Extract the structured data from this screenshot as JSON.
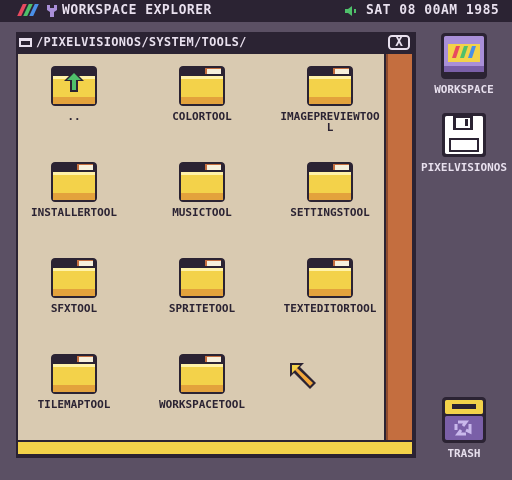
{
  "menubar": {
    "title": "WORKSPACE EXPLORER",
    "clock": "SAT 08 00AM 1985",
    "icons": [
      "pixelvision-logo-icon",
      "tool-icon",
      "speaker-icon"
    ]
  },
  "window": {
    "path": "/PIXELVISIONOS/SYSTEM/TOOLS/",
    "close_label": "X",
    "items": [
      {
        "label": "..",
        "kind": "parent-folder"
      },
      {
        "label": "COLORTOOL",
        "kind": "folder"
      },
      {
        "label": "IMAGEPREVIEWTOOL",
        "kind": "folder"
      },
      {
        "label": "INSTALLERTOOL",
        "kind": "folder"
      },
      {
        "label": "MUSICTOOL",
        "kind": "folder"
      },
      {
        "label": "SETTINGSTOOL",
        "kind": "folder"
      },
      {
        "label": "SFXTOOL",
        "kind": "folder"
      },
      {
        "label": "SPRITETOOL",
        "kind": "folder"
      },
      {
        "label": "TEXTEDITORTOOL",
        "kind": "folder"
      },
      {
        "label": "TILEMAPTOOL",
        "kind": "folder"
      },
      {
        "label": "WORKSPACETOOL",
        "kind": "folder"
      }
    ]
  },
  "desktop": {
    "workspace_label": "WORKSPACE",
    "disk_label": "PIXELVISIONOS",
    "trash_label": "TRASH"
  },
  "colors": {
    "background": "#5b5064",
    "dark": "#2b2333",
    "content": "#d9cab1",
    "accent": "#f3d24a",
    "scrollbar": "#c46e3f"
  }
}
